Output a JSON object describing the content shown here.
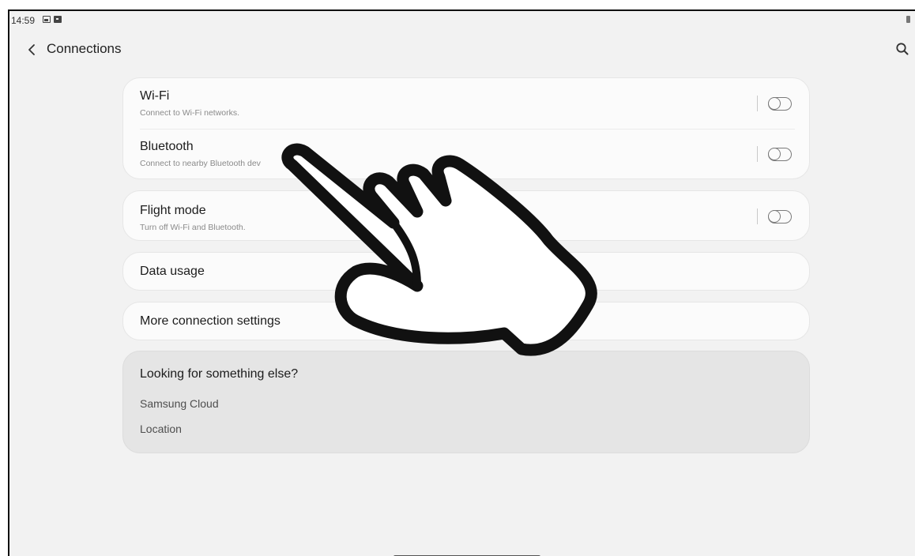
{
  "status_bar": {
    "time": "14:59"
  },
  "header": {
    "title": "Connections"
  },
  "groups": {
    "wireless": {
      "wifi": {
        "title": "Wi-Fi",
        "subtitle": "Connect to Wi-Fi networks.",
        "enabled": false
      },
      "bluetooth": {
        "title": "Bluetooth",
        "subtitle": "Connect to nearby Bluetooth dev",
        "enabled": false
      }
    },
    "flight": {
      "title": "Flight mode",
      "subtitle": "Turn off Wi-Fi and Bluetooth.",
      "enabled": false
    },
    "data_usage": {
      "title": "Data usage"
    },
    "more": {
      "title": "More connection settings"
    }
  },
  "suggestions": {
    "title": "Looking for something else?",
    "links": [
      "Samsung Cloud",
      "Location"
    ]
  },
  "icons": {
    "back": "chevron-left-icon",
    "search": "search-icon",
    "overlay": "pointing-hand-icon"
  }
}
